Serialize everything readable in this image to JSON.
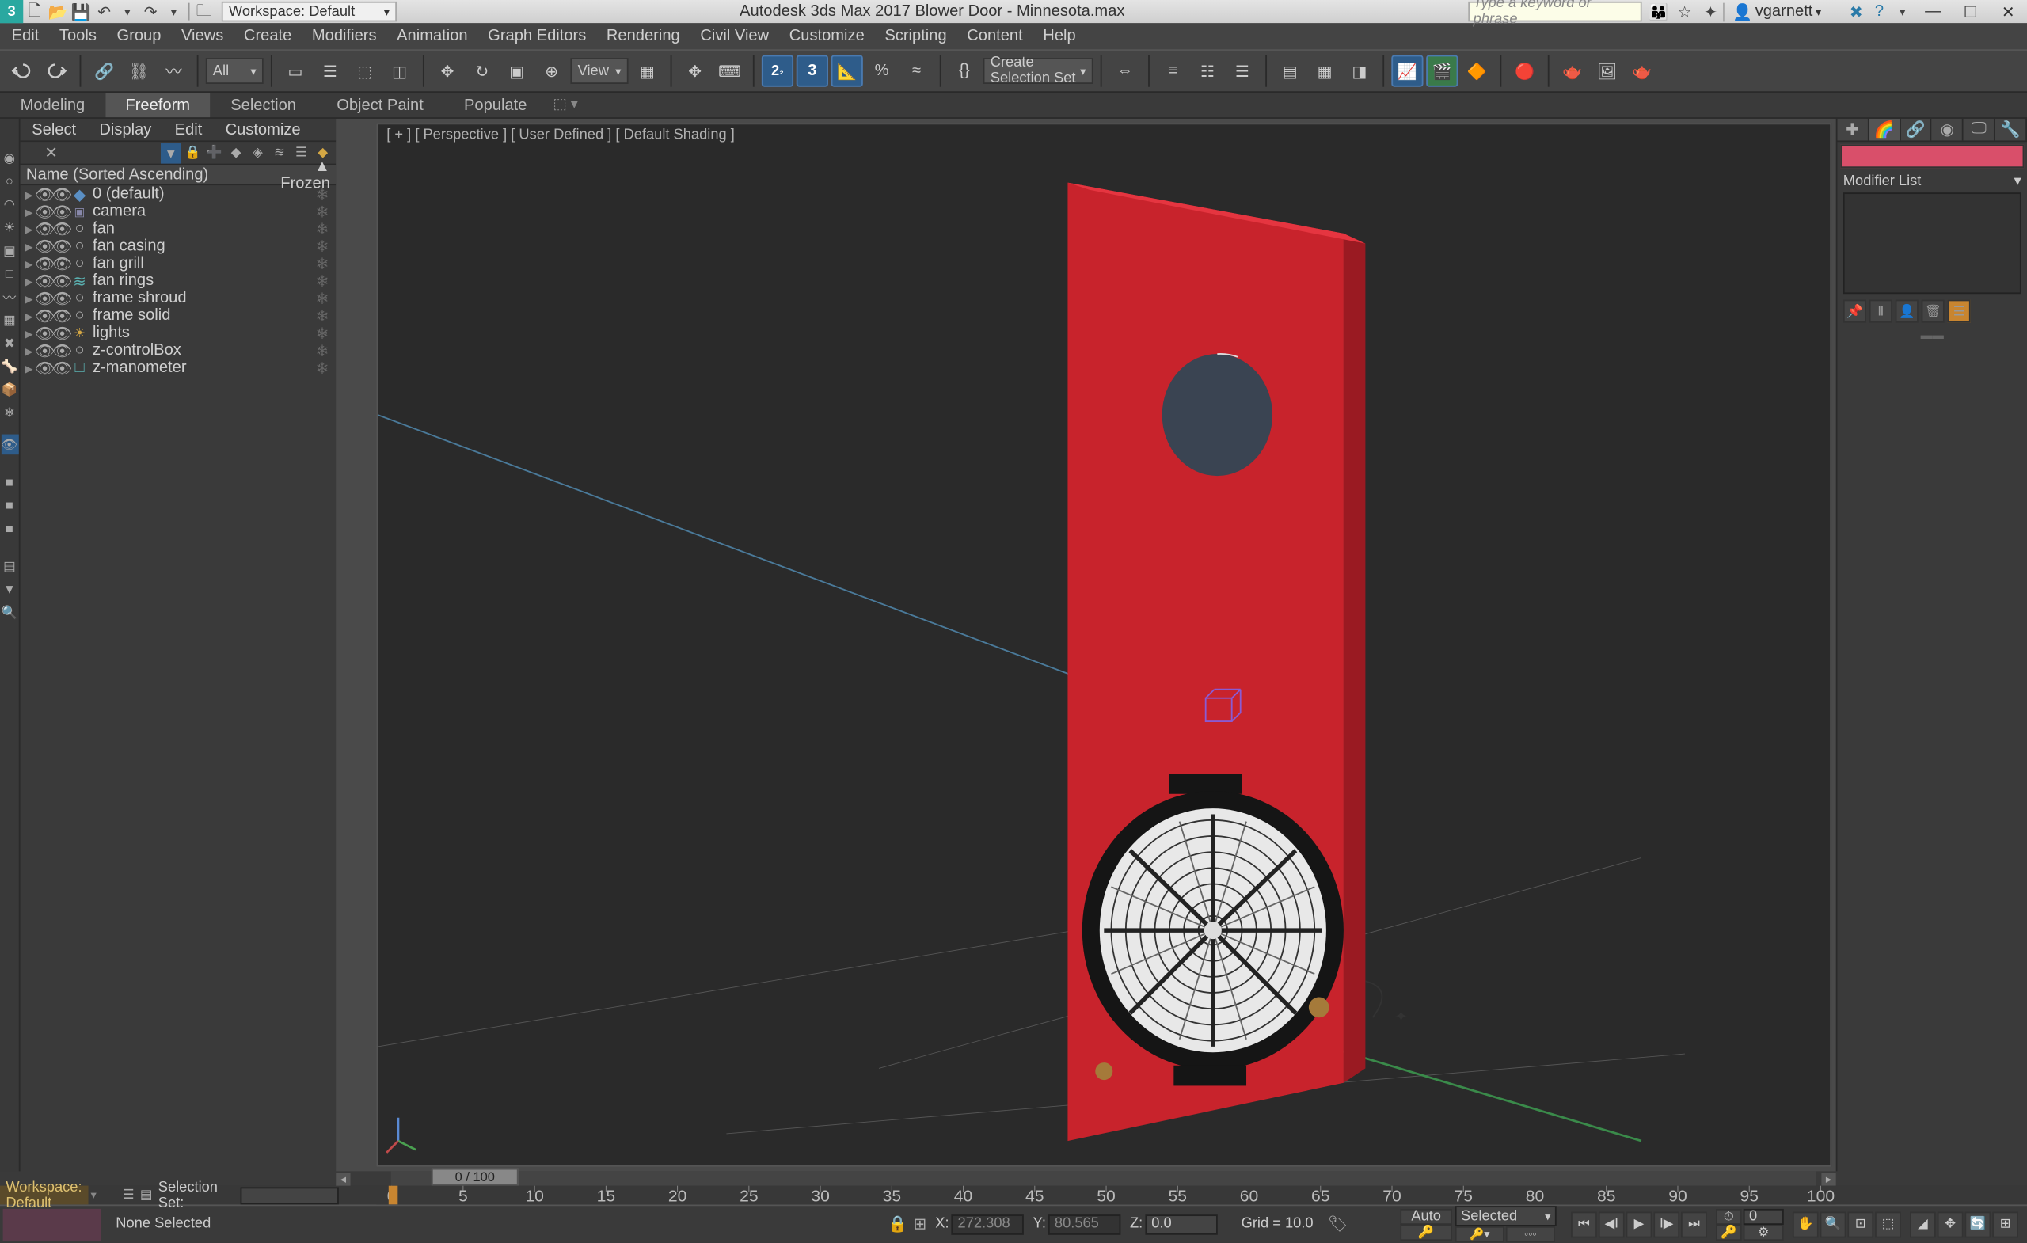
{
  "titlebar": {
    "workspace": "Workspace: Default",
    "app_title": "Autodesk 3ds Max 2017     Blower Door - Minnesota.max",
    "search_placeholder": "Type a keyword or phrase",
    "user": "vgarnett"
  },
  "menus": [
    "Edit",
    "Tools",
    "Group",
    "Views",
    "Create",
    "Modifiers",
    "Animation",
    "Graph Editors",
    "Rendering",
    "Civil View",
    "Customize",
    "Scripting",
    "Content",
    "Help"
  ],
  "toolbar": {
    "filter_all": "All",
    "view_label": "View",
    "sel_set_prompt": "Create Selection Set"
  },
  "ribbon_tabs": [
    "Modeling",
    "Freeform",
    "Selection",
    "Object Paint",
    "Populate"
  ],
  "ribbon_active": 1,
  "explorer": {
    "menus": [
      "Select",
      "Display",
      "Edit",
      "Customize"
    ],
    "col_name": "Name (Sorted Ascending)",
    "col_frozen": "▲ Frozen",
    "items": [
      {
        "type": "layer",
        "name": "0 (default)",
        "arrow": "▸"
      },
      {
        "type": "cam",
        "name": "camera",
        "arrow": "▸"
      },
      {
        "type": "geo",
        "name": "fan",
        "arrow": "▸"
      },
      {
        "type": "geo",
        "name": "fan casing",
        "arrow": "▸"
      },
      {
        "type": "geo",
        "name": "fan grill",
        "arrow": "▸"
      },
      {
        "type": "group",
        "name": "fan rings",
        "arrow": "▸"
      },
      {
        "type": "geo",
        "name": "frame shroud",
        "arrow": "▸"
      },
      {
        "type": "geo",
        "name": "frame solid",
        "arrow": "▸"
      },
      {
        "type": "light",
        "name": "lights",
        "arrow": "▸"
      },
      {
        "type": "geo",
        "name": "z-controlBox",
        "arrow": "▸"
      },
      {
        "type": "helper",
        "name": "z-manometer",
        "arrow": "▸"
      }
    ]
  },
  "viewport_label": "[ + ] [ Perspective ] [ User Defined ] [ Default Shading ]",
  "command_panel": {
    "modifier_list": "Modifier List"
  },
  "time_slider": {
    "label": "0 / 100",
    "start": 0,
    "end": 100
  },
  "status": {
    "workspace": "Workspace: Default",
    "selection_set_label": "Selection Set:",
    "none_selected": "None Selected",
    "x": "272.308",
    "y": "80.565",
    "z": "0.0",
    "grid": "Grid = 10.0",
    "auto": "Auto",
    "selected": "Selected"
  }
}
